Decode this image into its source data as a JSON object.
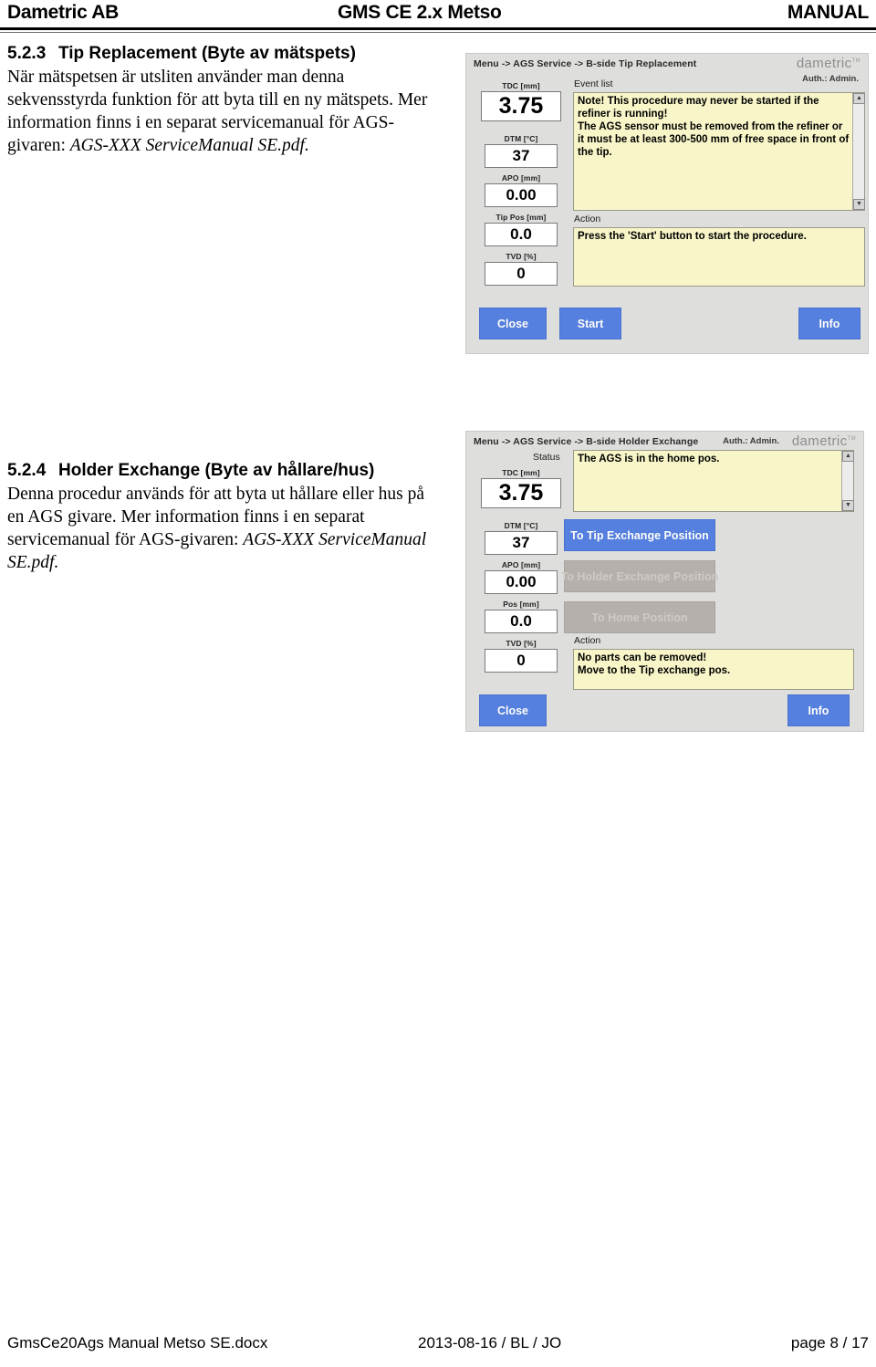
{
  "header": {
    "left": "Dametric AB",
    "center": "GMS CE 2.x Metso",
    "right": "MANUAL"
  },
  "sections": [
    {
      "number": "5.2.3",
      "title": "Tip Replacement (Byte av mätspets)",
      "paragraph": "När mätspetsen är utsliten använder man denna sekvensstyrda funktion för att byta till en ny mätspets.\nMer information finns i en separat servicemanual för AGS-givaren:",
      "reference": "AGS-XXX ServiceManual SE.pdf."
    },
    {
      "number": "5.2.4",
      "title": "Holder Exchange (Byte av hållare/hus)",
      "paragraph": "Denna procedur används för att byta ut hållare eller hus på en AGS givare.\nMer information finns i en separat servicemanual för AGS-givaren:",
      "reference": "AGS-XXX ServiceManual SE.pdf."
    }
  ],
  "hmi_tip": {
    "breadcrumb": "Menu -> AGS Service -> B-side Tip Replacement",
    "brand": "dametric",
    "brand_tm": "TM",
    "auth": "Auth.: Admin.",
    "readouts": [
      {
        "label": "TDC [mm]",
        "value": "3.75"
      },
      {
        "label": "DTM [°C]",
        "value": "37"
      },
      {
        "label": "APO [mm]",
        "value": "0.00"
      },
      {
        "label": "Tip Pos [mm]",
        "value": "0.0"
      },
      {
        "label": "TVD [%]",
        "value": "0"
      }
    ],
    "event_list_label": "Event list",
    "event_list_text": "Note! This procedure may never be started if the refiner is running!\nThe AGS sensor must be removed from the refiner or it must be at least 300-500 mm of free space in front of the tip.",
    "action_label": "Action",
    "action_text": "Press the 'Start' button to start the procedure.",
    "buttons": {
      "close": "Close",
      "start": "Start",
      "info": "Info"
    }
  },
  "hmi_holder": {
    "breadcrumb": "Menu -> AGS Service -> B-side Holder Exchange",
    "brand": "dametric",
    "brand_tm": "TM",
    "auth": "Auth.: Admin.",
    "readouts": [
      {
        "label": "TDC [mm]",
        "value": "3.75"
      },
      {
        "label": "DTM [°C]",
        "value": "37"
      },
      {
        "label": "APO [mm]",
        "value": "0.00"
      },
      {
        "label": "Pos [mm]",
        "value": "0.0"
      },
      {
        "label": "TVD [%]",
        "value": "0"
      }
    ],
    "status_label": "Status",
    "status_text": "The AGS is in the home pos.",
    "action_label": "Action",
    "action_text": "No parts can be removed!\nMove to the Tip exchange pos.",
    "buttons": {
      "to_tip": "To Tip Exchange Position",
      "to_holder": "To Holder Exchange Position",
      "to_home": "To Home Position",
      "close": "Close",
      "info": "Info"
    }
  },
  "footer": {
    "file": "GmsCe20Ags Manual Metso SE.docx",
    "date": "2013-08-16 / BL / JO",
    "page": "page 8 / 17"
  },
  "colors": {
    "button_primary": "#5580e0",
    "button_disabled": "#b5b0ac",
    "panel_background": "#dededd",
    "textarea_yellow": "#f8f6c8",
    "brand_gray": "#8d8d8d"
  }
}
